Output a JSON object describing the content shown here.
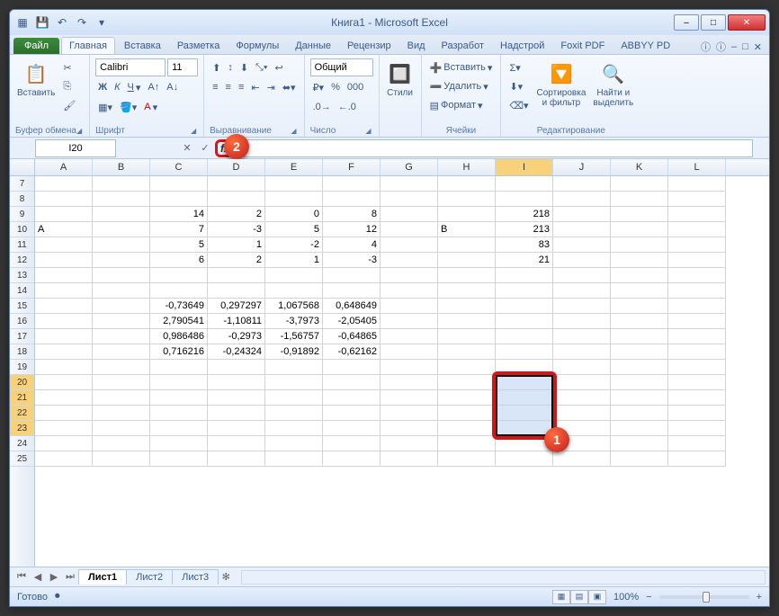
{
  "title": "Книга1  -  Microsoft Excel",
  "qat_icons": [
    "excel-icon",
    "save-icon",
    "undo-icon",
    "redo-icon"
  ],
  "win_buttons": {
    "min": "–",
    "max": "□",
    "close": "✕"
  },
  "tabs": {
    "file": "Файл",
    "list": [
      "Главная",
      "Вставка",
      "Разметка",
      "Формулы",
      "Данные",
      "Рецензир",
      "Вид",
      "Разработ",
      "Надстрой",
      "Foxit PDF",
      "ABBYY PD"
    ],
    "active": 0
  },
  "ribbon": {
    "clipboard": {
      "paste": "Вставить",
      "label": "Буфер обмена"
    },
    "font": {
      "name": "Calibri",
      "size": "11",
      "label": "Шрифт"
    },
    "align": {
      "label": "Выравнивание"
    },
    "number": {
      "format": "Общий",
      "label": "Число"
    },
    "styles": {
      "btn": "Стили",
      "label": ""
    },
    "cells": {
      "insert": "Вставить",
      "delete": "Удалить",
      "format": "Формат",
      "label": "Ячейки"
    },
    "editing": {
      "sort": "Сортировка\nи фильтр",
      "find": "Найти и\nвыделить",
      "label": "Редактирование"
    }
  },
  "namebox": "I20",
  "fx_label": "fx",
  "columns": [
    "A",
    "B",
    "C",
    "D",
    "E",
    "F",
    "G",
    "H",
    "I",
    "J",
    "K",
    "L"
  ],
  "selected_col": "I",
  "row_start": 7,
  "row_end": 25,
  "selected_rows": [
    20,
    21,
    22,
    23
  ],
  "cells": {
    "9": {
      "C": "14",
      "D": "2",
      "E": "0",
      "F": "8",
      "I": "218"
    },
    "10": {
      "A": "А",
      "C": "7",
      "D": "-3",
      "E": "5",
      "F": "12",
      "H": "В",
      "I": "213"
    },
    "11": {
      "C": "5",
      "D": "1",
      "E": "-2",
      "F": "4",
      "I": "83"
    },
    "12": {
      "C": "6",
      "D": "2",
      "E": "1",
      "F": "-3",
      "I": "21"
    },
    "15": {
      "C": "-0,73649",
      "D": "0,297297",
      "E": "1,067568",
      "F": "0,648649"
    },
    "16": {
      "C": "2,790541",
      "D": "-1,10811",
      "E": "-3,7973",
      "F": "-2,05405"
    },
    "17": {
      "C": "0,986486",
      "D": "-0,2973",
      "E": "-1,56757",
      "F": "-0,64865"
    },
    "18": {
      "C": "0,716216",
      "D": "-0,24324",
      "E": "-0,91892",
      "F": "-0,62162"
    }
  },
  "callouts": {
    "fx": "2",
    "sel": "1"
  },
  "sheets": {
    "list": [
      "Лист1",
      "Лист2",
      "Лист3"
    ],
    "active": 0
  },
  "status": {
    "ready": "Готово",
    "zoom": "100%",
    "minus": "−",
    "plus": "+"
  }
}
